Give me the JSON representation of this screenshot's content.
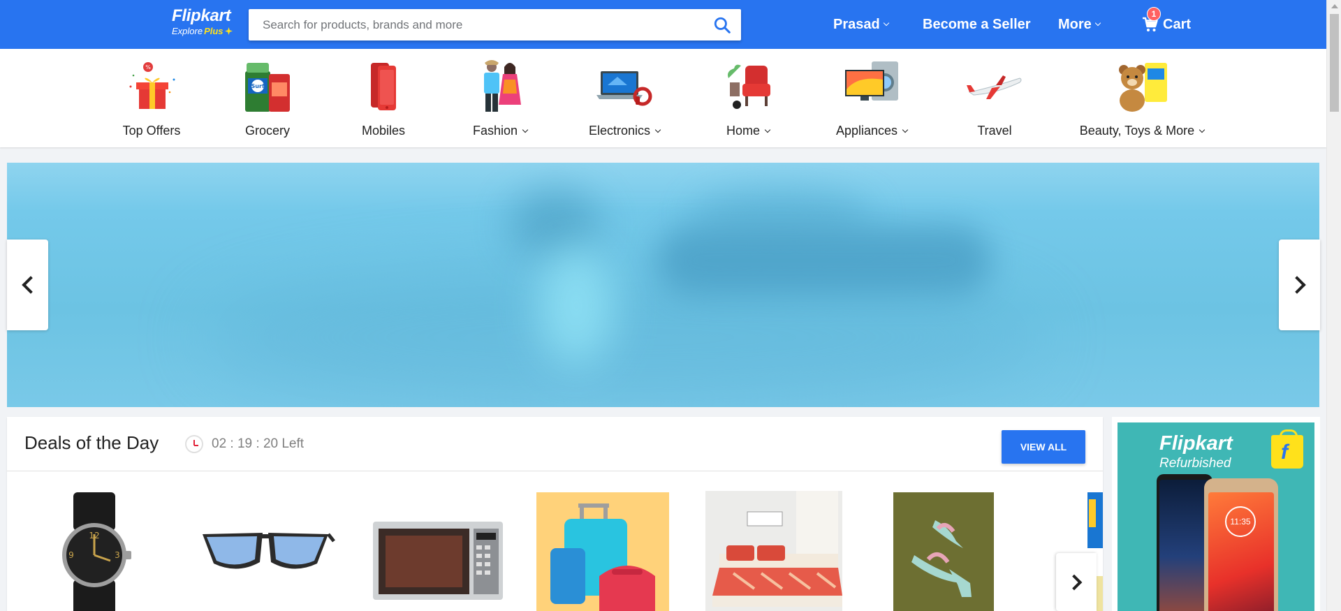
{
  "header": {
    "logo_text": "Flipkart",
    "logo_subtext": "Explore",
    "logo_plus": "Plus",
    "search_placeholder": "Search for products, brands and more",
    "user_label": "Prasad",
    "seller_label": "Become a Seller",
    "more_label": "More",
    "cart_label": "Cart",
    "cart_count": "1",
    "brand_color": "#2874f0"
  },
  "categories": [
    {
      "label": "Top Offers",
      "icon": "gift-icon",
      "dropdown": false
    },
    {
      "label": "Grocery",
      "icon": "grocery-icon",
      "dropdown": false
    },
    {
      "label": "Mobiles",
      "icon": "mobile-icon",
      "dropdown": false
    },
    {
      "label": "Fashion",
      "icon": "fashion-icon",
      "dropdown": true
    },
    {
      "label": "Electronics",
      "icon": "laptop-icon",
      "dropdown": true
    },
    {
      "label": "Home",
      "icon": "armchair-icon",
      "dropdown": true
    },
    {
      "label": "Appliances",
      "icon": "tv-washer-icon",
      "dropdown": true
    },
    {
      "label": "Travel",
      "icon": "airplane-icon",
      "dropdown": false
    },
    {
      "label": "Beauty, Toys & More",
      "icon": "teddy-bear-icon",
      "dropdown": true
    }
  ],
  "deals": {
    "title": "Deals of the Day",
    "timer": "02 : 19 : 20 Left",
    "view_all_label": "VIEW ALL",
    "items": [
      {
        "icon": "watch-icon"
      },
      {
        "icon": "sunglasses-icon"
      },
      {
        "icon": "microwave-icon"
      },
      {
        "icon": "luggage-icon"
      },
      {
        "icon": "bed-icon"
      },
      {
        "icon": "sandal-icon"
      }
    ]
  },
  "side_ad": {
    "brand": "Flipkart",
    "sub": "Refurbished",
    "bag_letter": "f",
    "phone_time": "11:35"
  }
}
